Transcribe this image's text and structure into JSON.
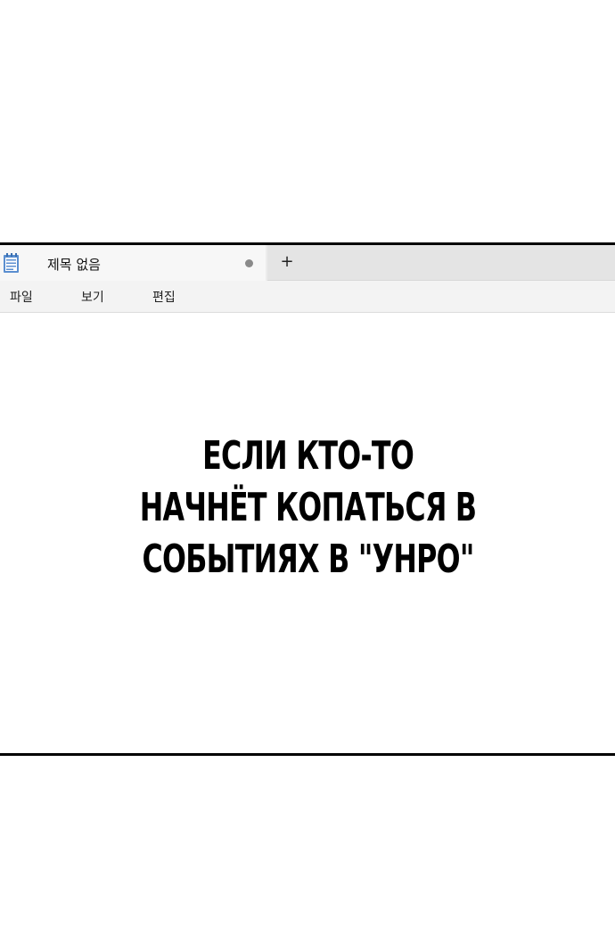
{
  "window": {
    "tab": {
      "title": "제목 없음",
      "icon": "notepad-icon",
      "unsaved_indicator": "modified-dot-icon"
    },
    "new_tab_label": "+",
    "menu": {
      "file": "파일",
      "view": "보기",
      "edit": "편집"
    }
  },
  "editor": {
    "lines": [
      "ЕСЛИ КТО-ТО",
      "НАЧНЁТ КОПАТЬСЯ В",
      "СОБЫТИЯХ В \"УНРО\""
    ]
  },
  "colors": {
    "frame_border": "#000000",
    "tab_active_bg": "#f7f7f7",
    "tab_strip_bg": "#e4e4e4",
    "menubar_bg": "#f3f3f3",
    "icon_blue": "#5b8fd0",
    "text": "#000000"
  }
}
